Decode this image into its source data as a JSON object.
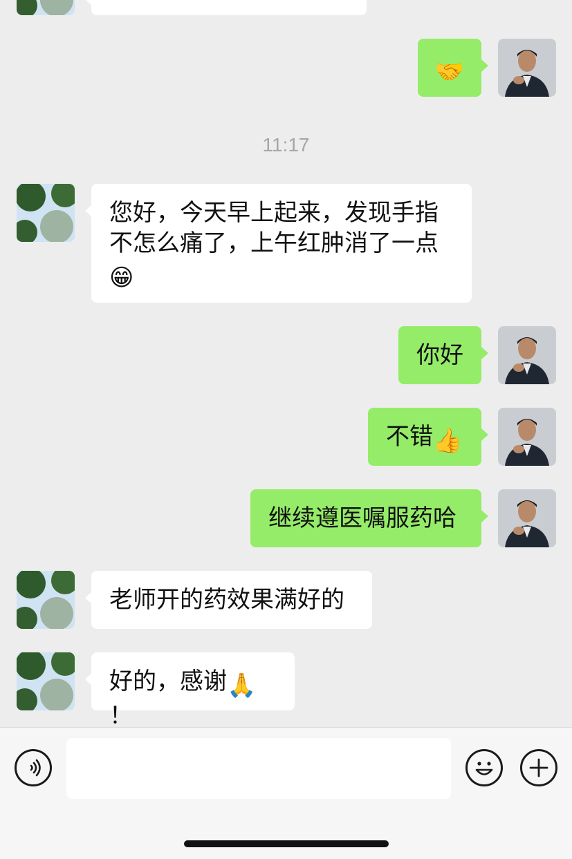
{
  "messages": {
    "m0": {
      "text": ""
    },
    "m1": {
      "text": "🤝"
    },
    "time": "11:17",
    "m2": {
      "line1": "您好，今天早上起来，发现手指",
      "line2": "不怎么痛了，上午红肿消了一点",
      "emoji": "😁"
    },
    "m3": {
      "text": "你好"
    },
    "m4": {
      "text": "不错",
      "emoji": "👍"
    },
    "m5": {
      "text": "继续遵医嘱服药哈"
    },
    "m6": {
      "text": "老师开的药效果满好的"
    },
    "m7": {
      "text": "好的，感谢",
      "emoji": "🙏",
      "tail": "！"
    }
  },
  "input": {
    "value": ""
  },
  "icons": {
    "voice": "voice-icon",
    "emoji": "emoji-icon",
    "plus": "plus-icon",
    "avatar_in": "tree-avatar",
    "avatar_out": "man-avatar"
  },
  "colors": {
    "background": "#ededed",
    "outgoing_bubble": "#95ec69",
    "incoming_bubble": "#ffffff",
    "timestamp": "#a6a6a6"
  }
}
